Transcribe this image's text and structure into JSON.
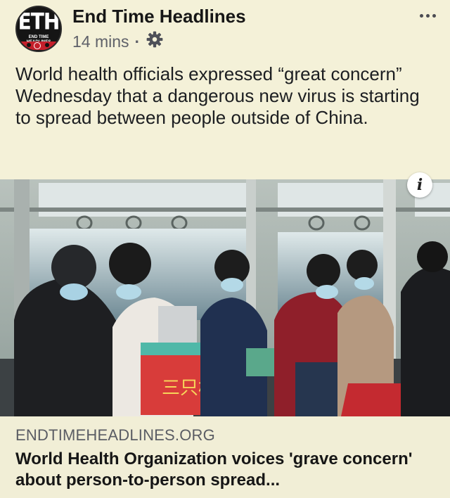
{
  "post": {
    "page_name": "End Time Headlines",
    "timestamp": "14 mins",
    "separator": "·",
    "privacy_icon": "gear-icon",
    "more_icon": "more-dots-icon",
    "body": "World health officials expressed “great concern” Wednesday that a dangerous new virus is starting to spread between people outside of China."
  },
  "avatar": {
    "logo_text": "ETH",
    "logo_subtext": "END TIME HEADLINES"
  },
  "image": {
    "info_icon": "info-icon",
    "info_label": "i",
    "bag_text": "三只松鼠"
  },
  "link": {
    "domain": "ENDTIMEHEADLINES.ORG",
    "title": "World Health Organization voices 'grave concern' about person-to-person spread..."
  },
  "colors": {
    "background": "#f4f1d8",
    "text": "#1c1e21",
    "meta": "#5f6169",
    "logo_red": "#c41f2b"
  }
}
